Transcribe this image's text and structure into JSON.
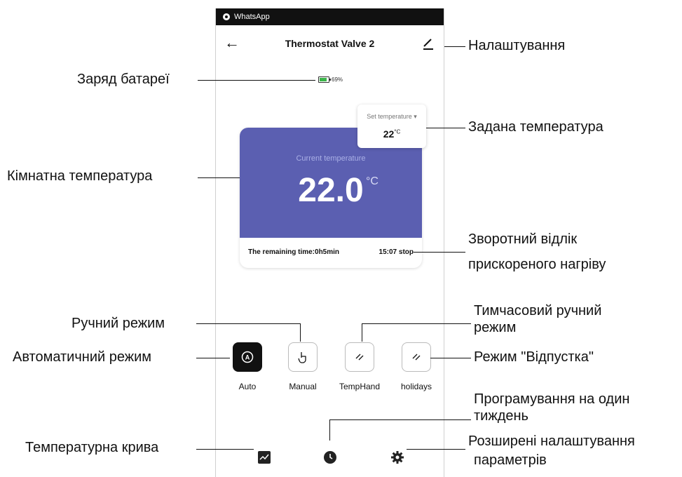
{
  "status_bar": {
    "app_name": "WhatsApp"
  },
  "header": {
    "title": "Thermostat Valve 2"
  },
  "battery": {
    "percent_label": "69%",
    "level": 0.69
  },
  "set_temperature": {
    "label": "Set temperature ▾",
    "value": "22",
    "unit": "°C"
  },
  "current": {
    "label": "Current temperature",
    "value": "22.0",
    "unit": "°C"
  },
  "boost": {
    "remaining": "The remaining time:0h5min",
    "stop": "15:07 stop"
  },
  "modes": [
    {
      "label": "Auto",
      "icon": "auto-icon",
      "active": true
    },
    {
      "label": "Manual",
      "icon": "hand-icon",
      "active": false
    },
    {
      "label": "TempHand",
      "icon": "temphand-icon",
      "active": false
    },
    {
      "label": "holidays",
      "icon": "holidays-icon",
      "active": false
    }
  ],
  "bottom_icons": [
    "chart-icon",
    "clock-icon",
    "gear-icon"
  ],
  "annotations": {
    "settings": "Налаштування",
    "battery": "Заряд батареї",
    "set_temp": "Задана температура",
    "room_temp": "Кімнатна температура",
    "boost_line1": "Зворотний відлік",
    "boost_line2": "прискореного нагріву",
    "manual": "Ручний режим",
    "temphand_line1": "Тимчасовий ручний",
    "temphand_line2": "режим",
    "auto": "Автоматичний режим",
    "holiday": "Режим \"Відпустка\"",
    "weekly_line1": "Програмування на один",
    "weekly_line2": "тиждень",
    "curve": "Температурна крива",
    "advanced_line1": "Розширені налаштування",
    "advanced_line2": "параметрів"
  }
}
